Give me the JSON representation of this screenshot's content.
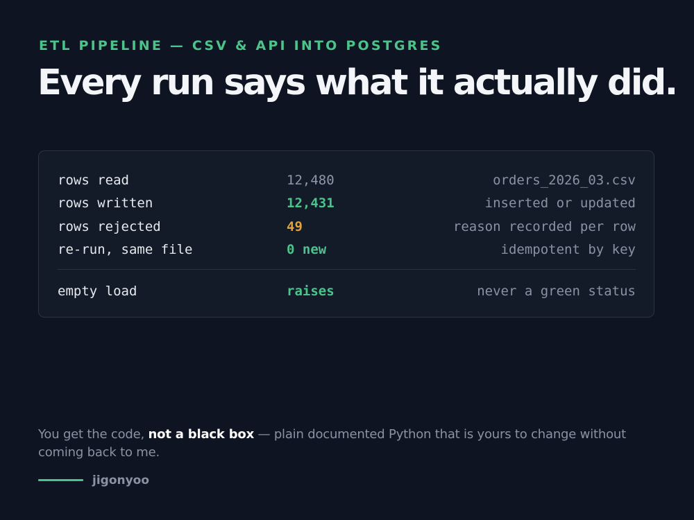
{
  "eyebrow": "ETL PIPELINE — CSV & API INTO POSTGRES",
  "headline": "Every run says what it actually did.",
  "summary": {
    "rows": [
      {
        "label": "rows read",
        "value": "12,480",
        "note": "orders_2026_03.csv",
        "tone": "neutral"
      },
      {
        "label": "rows written",
        "value": "12,431",
        "note": "inserted or updated",
        "tone": "good"
      },
      {
        "label": "rows rejected",
        "value": "49",
        "note": "reason recorded per row",
        "tone": "warn"
      },
      {
        "label": "re-run, same file",
        "value": "0 new",
        "note": "idempotent by key",
        "tone": "good"
      }
    ],
    "failure_row": {
      "label": "empty load",
      "value": "raises",
      "note": "never a green status",
      "tone": "good"
    }
  },
  "footer": {
    "before": "You get the code, ",
    "emphasis": "not a black box",
    "after": " — plain documented Python that is yours to change without coming back to me."
  },
  "signature": {
    "name": "jigonyoo"
  },
  "colors": {
    "background": "#0e1421",
    "panel": "#131b29",
    "accent_green": "#4cc38a",
    "warning_amber": "#e0a23b"
  }
}
